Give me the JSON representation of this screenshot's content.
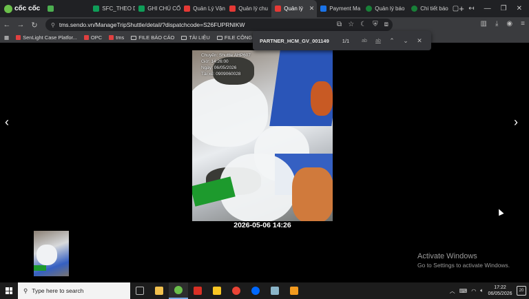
{
  "browser": {
    "brand": "cốc cốc",
    "tabs": [
      {
        "label": "",
        "color": "#4caf50"
      },
      {
        "label": "SFC_THEO D",
        "color": "#0f9d58"
      },
      {
        "label": "GHI CHÚ CỐ",
        "color": "#0f9d58"
      },
      {
        "label": "Quản Lý Vận",
        "color": "#e53935"
      },
      {
        "label": "Quản lý chu",
        "color": "#e53935"
      },
      {
        "label": "Quản lý",
        "color": "#e53935",
        "active": true
      },
      {
        "label": "Payment Ma",
        "color": "#1a73e8"
      },
      {
        "label": "Quản lý báo",
        "color": "#188038"
      },
      {
        "label": "Chi tiết báo",
        "color": "#188038"
      }
    ],
    "url": "tms.sendo.vn/ManageTripShuttle/detail/?dispatchcode=S26FUPRNIKW",
    "bookmarks": [
      {
        "label": "SenLight Case Platfor...",
        "type": "site"
      },
      {
        "label": "OPC",
        "type": "site"
      },
      {
        "label": "tms",
        "type": "site"
      },
      {
        "label": "FILE BÁO CÁO",
        "type": "folder"
      },
      {
        "label": "TÀI LIỆU",
        "type": "folder"
      },
      {
        "label": "FILE CÔNG VIỆC",
        "type": "folder"
      }
    ]
  },
  "find_bar": {
    "query": "PARTNER_HCM_GV_001149",
    "count": "1/1",
    "opt_case": "ab",
    "opt_word": "ab"
  },
  "viewer": {
    "photo_overlay": [
      "Chuyến: Shuttle AHP607",
      "Giờ: 14:26:00",
      "Ngày: 06/05/2026",
      "Tài xế: 0909060028"
    ],
    "caption": "2026-05-06 14:26",
    "prev_arrow": "‹",
    "next_arrow": "›"
  },
  "windows_notice": {
    "title": "Activate Windows",
    "subtitle": "Go to Settings to activate Windows."
  },
  "taskbar": {
    "search_placeholder": "Type here to search",
    "time": "17:22",
    "date": "06/05/2026",
    "notifications": "20",
    "apps": [
      {
        "name": "task-view",
        "color": "#bbbbbb"
      },
      {
        "name": "file-explorer",
        "color": "#f2c14e"
      },
      {
        "name": "coccoc",
        "color": "#6bc04b",
        "active": true
      },
      {
        "name": "wps",
        "color": "#d93025"
      },
      {
        "name": "sticky-notes",
        "color": "#f9c623"
      },
      {
        "name": "chrome",
        "color": "#ea4335"
      },
      {
        "name": "zalo",
        "color": "#0068ff"
      },
      {
        "name": "notepad",
        "color": "#8ab4c8"
      },
      {
        "name": "app-orange",
        "color": "#f29a1f"
      }
    ]
  }
}
